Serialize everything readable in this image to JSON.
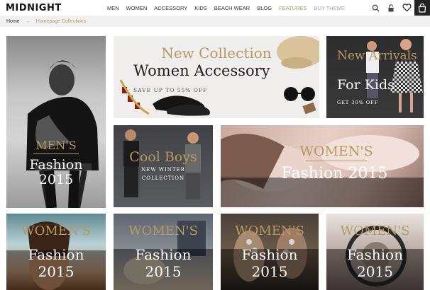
{
  "header": {
    "logo": "MIDNIGHT",
    "nav": [
      {
        "label": "MEN"
      },
      {
        "label": "WOMEN"
      },
      {
        "label": "ACCESSORY"
      },
      {
        "label": "KIDS"
      },
      {
        "label": "BEACH WEAR"
      },
      {
        "label": "BLOG"
      },
      {
        "label": "FEATURES"
      },
      {
        "label": "BUY THEME"
      }
    ],
    "icons": [
      "search-icon",
      "lock-icon",
      "heart-icon",
      "shopping-bag-icon"
    ]
  },
  "breadcrumb": {
    "home": "Home",
    "separator": "→",
    "current": "Homepage Collections"
  },
  "tiles": {
    "mens": {
      "kicker": "MEN'S",
      "title": "Fashion",
      "year": "2015"
    },
    "women_accessory": {
      "kicker": "New Collection",
      "title": "Women Accessory",
      "sub": "SAVE UP TO 55% OFF"
    },
    "kids": {
      "kicker": "New Arrivals",
      "title": "For Kids",
      "sub": "GET 30% OFF"
    },
    "cool_boys": {
      "title": "Cool Boys",
      "sub1": "NEW WINTER",
      "sub2": "COLLECTION"
    },
    "womens_wide": {
      "kicker": "WOMEN'S",
      "title": "Fashion 2015"
    },
    "womens_1": {
      "kicker": "WOMEN'S",
      "title": "Fashion",
      "year": "2015"
    },
    "womens_2": {
      "kicker": "WOMEN'S",
      "title": "Fashion",
      "year": "2015"
    },
    "womens_3": {
      "kicker": "WOMEN'S",
      "title": "Fashion",
      "year": "2015"
    },
    "womens_4": {
      "kicker": "WOMEN'S",
      "title": "Fashion",
      "year": "2015"
    }
  },
  "colors": {
    "accent_gold": "#b49a60",
    "dark": "#222222"
  }
}
